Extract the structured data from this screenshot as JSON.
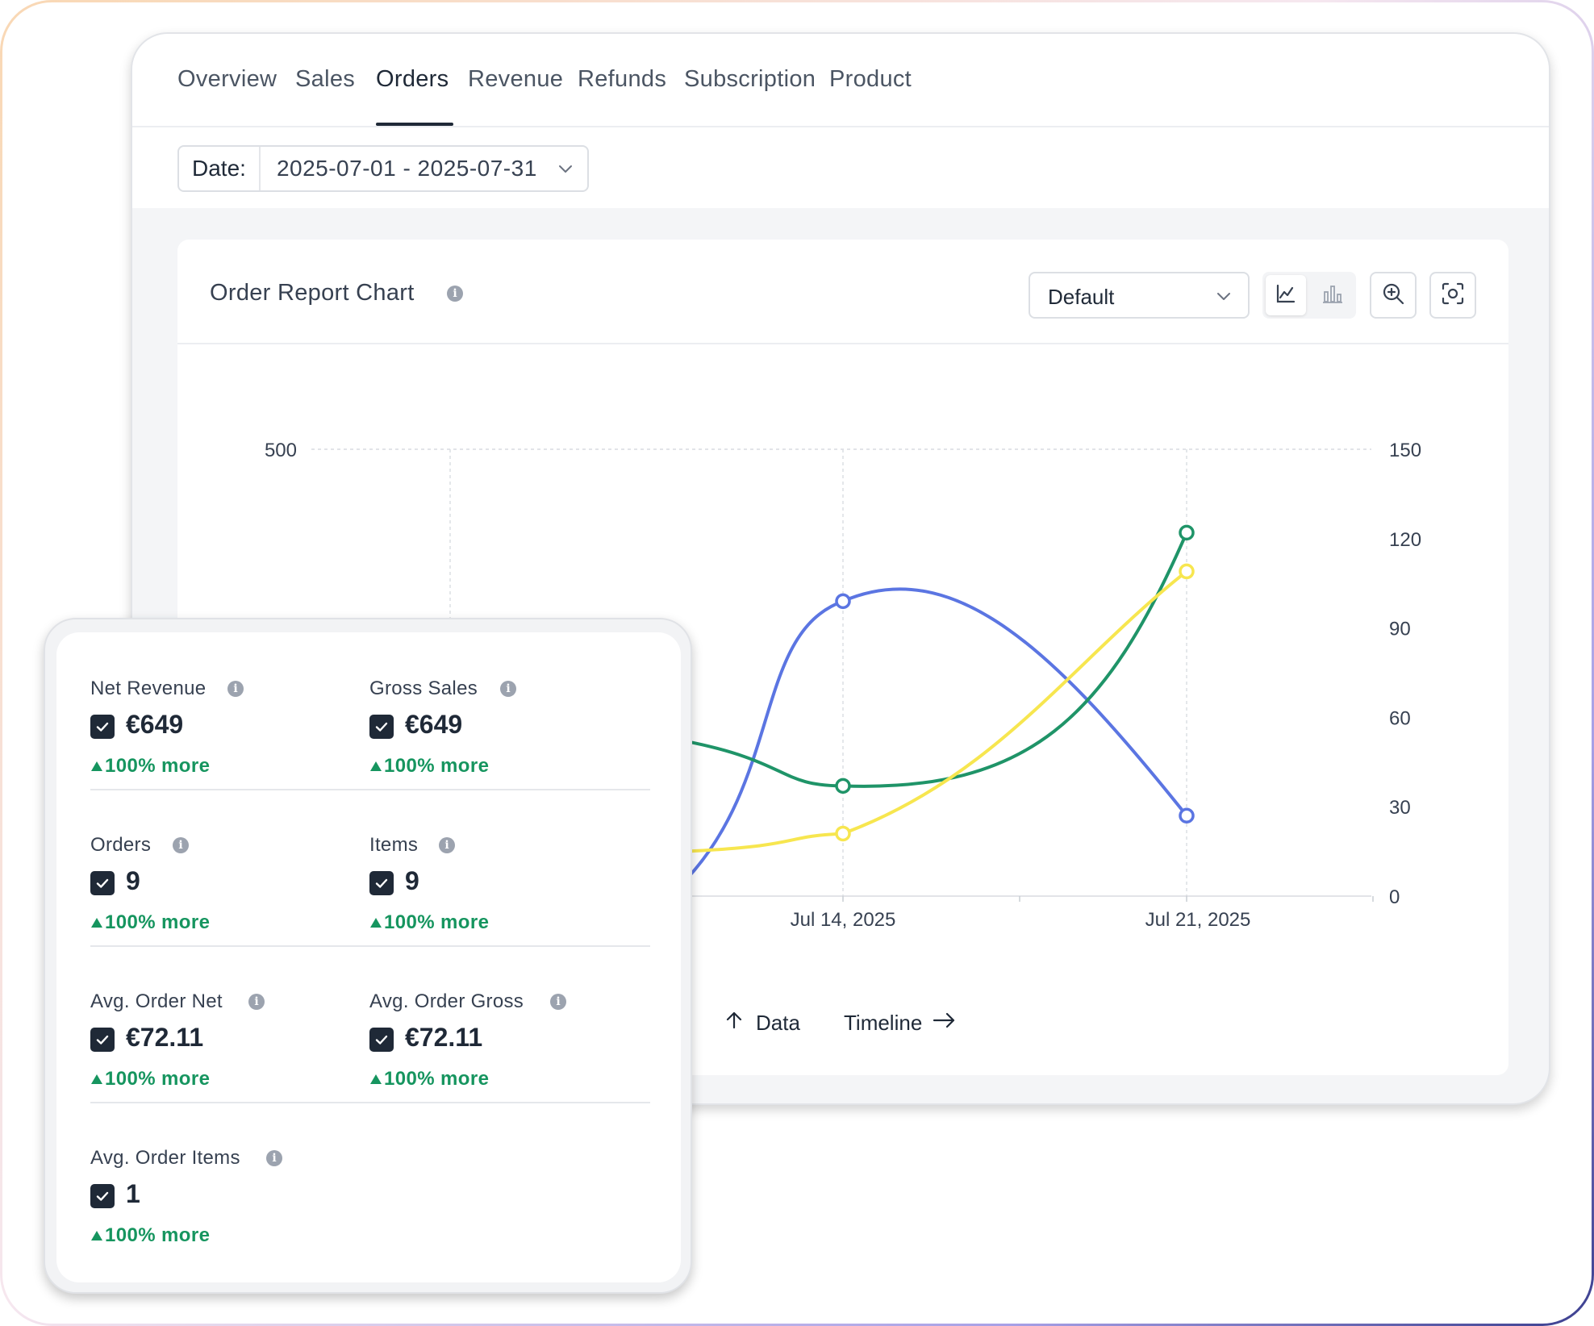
{
  "tabs": [
    {
      "label": "Overview"
    },
    {
      "label": "Sales"
    },
    {
      "label": "Orders",
      "active": true
    },
    {
      "label": "Revenue"
    },
    {
      "label": "Refunds"
    },
    {
      "label": "Subscription"
    },
    {
      "label": "Product"
    }
  ],
  "date_filter": {
    "label": "Date:",
    "value": "2025-07-01 - 2025-07-31"
  },
  "chart_panel": {
    "title": "Order Report Chart",
    "select_value": "Default",
    "footer_data_label": "Data",
    "footer_timeline_label": "Timeline"
  },
  "chart_data": {
    "type": "line",
    "x_tick_labels": [
      "Jul 14, 2025",
      "Jul 21, 2025"
    ],
    "y_left_ticks": [
      "500"
    ],
    "y_right_ticks": [
      "0",
      "30",
      "60",
      "90",
      "120",
      "150"
    ],
    "y_right_range": [
      0,
      150
    ],
    "grid": true,
    "series": [
      {
        "color": "#5b75e2",
        "points": [
          {
            "x": "Jul 14, 2025",
            "y": 99
          },
          {
            "x": "Jul 21, 2025",
            "y": 27
          }
        ]
      },
      {
        "color": "#1f9468",
        "points": [
          {
            "x": "Jul 14, 2025",
            "y": 37
          },
          {
            "x": "Jul 21, 2025",
            "y": 122
          }
        ]
      },
      {
        "color": "#f7e64f",
        "points": [
          {
            "x": "Jul 14, 2025",
            "y": 21
          },
          {
            "x": "Jul 21, 2025",
            "y": 109
          }
        ]
      }
    ]
  },
  "stats": [
    {
      "label": "Net Revenue",
      "value": "€649",
      "change": "100% more"
    },
    {
      "label": "Gross Sales",
      "value": "€649",
      "change": "100% more"
    },
    {
      "label": "Orders",
      "value": "9",
      "change": "100% more"
    },
    {
      "label": "Items",
      "value": "9",
      "change": "100% more"
    },
    {
      "label": "Avg. Order Net",
      "value": "€72.11",
      "change": "100% more"
    },
    {
      "label": "Avg. Order Gross",
      "value": "€72.11",
      "change": "100% more"
    },
    {
      "label": "Avg. Order Items",
      "value": "1",
      "change": "100% more"
    }
  ],
  "colors": {
    "accent": "#1f2937",
    "positive": "#16955f"
  },
  "icons": {
    "date_dropdown": "chevron-down-icon",
    "select_dropdown": "chevron-down-icon",
    "line_chart_button": "line-chart-icon",
    "bar_chart_button": "bar-chart-icon",
    "zoom_button": "zoom-in-icon",
    "screenshot_button": "screenshot-icon",
    "info": "info-icon",
    "checkbox": "check-icon",
    "change_arrow": "triangle-up-icon",
    "footer_left": "arrow-up-icon",
    "footer_right": "arrow-right-icon"
  }
}
